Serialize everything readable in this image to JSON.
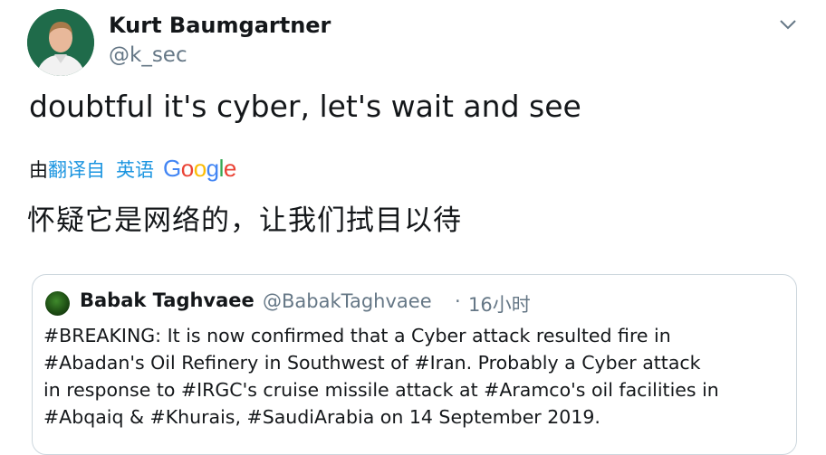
{
  "tweet": {
    "author": {
      "display_name": "Kurt Baumgartner",
      "handle": "@k_sec"
    },
    "text": "doubtful it's cyber, let's wait and see",
    "translation": {
      "prefix": "由",
      "link_label": "翻译自",
      "source_language": "英语",
      "provider": "Google",
      "text": "怀疑它是网络的，让我们拭目以待"
    }
  },
  "quoted_tweet": {
    "author": {
      "display_name": "Babak Taghvaee",
      "handle": "@BabakTaghvaee"
    },
    "separator": "·",
    "time": "16小时",
    "lines": [
      "#BREAKING: It is now confirmed that a Cyber attack resulted fire in",
      "#Abadan's Oil Refinery in Southwest of #Iran. Probably a Cyber attack",
      "in response to #IRGC's cruise missile attack at #Aramco's oil facilities in",
      "#Abqaiq & #Khurais, #SaudiArabia on 14 September 2019."
    ]
  },
  "icons": {
    "menu": "chevron-down-icon"
  },
  "colors": {
    "text": "#14171a",
    "secondary": "#657786",
    "link": "#1b95e0",
    "border": "#ccd6dd",
    "google_blue": "#4285f4",
    "google_red": "#ea4335",
    "google_yellow": "#fbbc05",
    "google_green": "#34a853"
  }
}
